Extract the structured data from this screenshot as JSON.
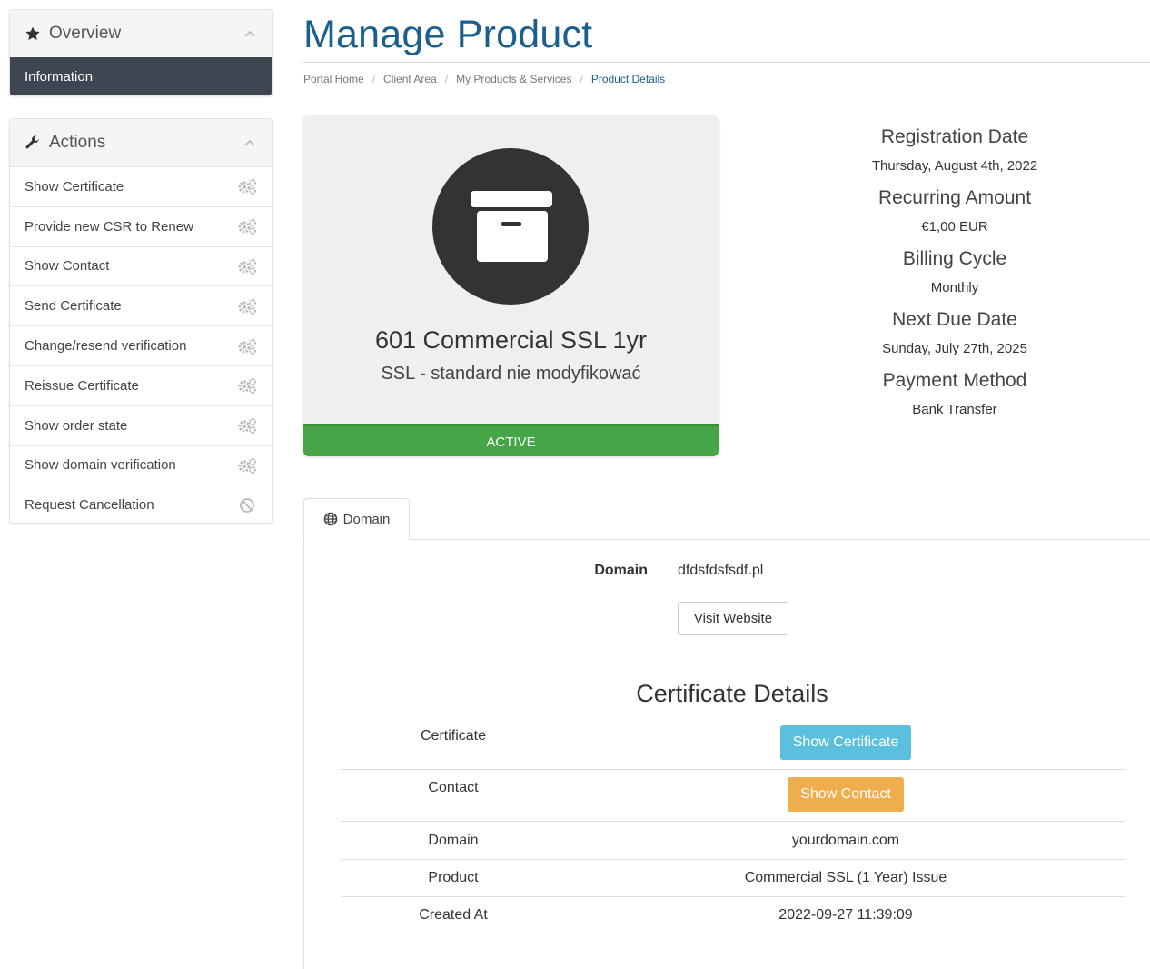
{
  "sidebar": {
    "overview": {
      "title": "Overview",
      "icon": "star-icon",
      "items": [
        {
          "label": "Information",
          "active": true
        }
      ]
    },
    "actions": {
      "title": "Actions",
      "icon": "wrench-icon",
      "items": [
        {
          "label": "Show Certificate",
          "icon": "gears-icon"
        },
        {
          "label": "Provide new CSR to Renew",
          "icon": "gears-icon"
        },
        {
          "label": "Show Contact",
          "icon": "gears-icon"
        },
        {
          "label": "Send Certificate",
          "icon": "gears-icon"
        },
        {
          "label": "Change/resend verification",
          "icon": "gears-icon"
        },
        {
          "label": "Reissue Certificate",
          "icon": "gears-icon"
        },
        {
          "label": "Show order state",
          "icon": "gears-icon"
        },
        {
          "label": "Show domain verification",
          "icon": "gears-icon"
        },
        {
          "label": "Request Cancellation",
          "icon": "ban-icon"
        }
      ]
    }
  },
  "header": {
    "title": "Manage Product",
    "breadcrumb": [
      "Portal Home",
      "Client Area",
      "My Products & Services",
      "Product Details"
    ]
  },
  "product": {
    "icon": "archive-box-icon",
    "name": "601 Commercial SSL 1yr",
    "group": "SSL - standard nie modyfikować",
    "status": "ACTIVE"
  },
  "billing": [
    {
      "label": "Registration Date",
      "value": "Thursday, August 4th, 2022"
    },
    {
      "label": "Recurring Amount",
      "value": "€1,00 EUR"
    },
    {
      "label": "Billing Cycle",
      "value": "Monthly"
    },
    {
      "label": "Next Due Date",
      "value": "Sunday, July 27th, 2025"
    },
    {
      "label": "Payment Method",
      "value": "Bank Transfer"
    }
  ],
  "tabs": [
    {
      "label": "Domain",
      "icon": "globe-icon",
      "active": true
    }
  ],
  "domain": {
    "label": "Domain",
    "value": "dfdsfdsfsdf.pl",
    "visit_label": "Visit Website"
  },
  "certificate_details": {
    "title": "Certificate Details",
    "rows": [
      {
        "key": "Certificate",
        "button": "Show Certificate"
      },
      {
        "key": "Contact",
        "button": "Show Contact"
      },
      {
        "key": "Domain",
        "value": "yourdomain.com"
      },
      {
        "key": "Product",
        "value": "Commercial SSL (1 Year) Issue"
      },
      {
        "key": "Created At",
        "value": "2022-09-27 11:39:09"
      }
    ]
  },
  "colors": {
    "title": "#1a5f8e",
    "sidebar_active": "#3f4651",
    "status_active": "#46a546",
    "btn_info": "#5bc0de",
    "btn_warning": "#f0ad4e"
  }
}
